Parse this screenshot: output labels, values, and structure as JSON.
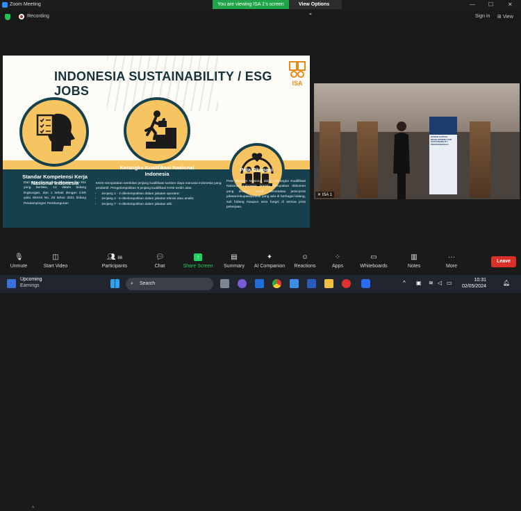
{
  "window": {
    "title": "Zoom Meeting"
  },
  "banner": {
    "message": "You are viewing ISA 1's screen",
    "options_label": "View Options"
  },
  "topbar": {
    "recording_label": "Recording",
    "signin_label": "Sign in",
    "view_label": "View"
  },
  "slide": {
    "title": "INDONESIA SUSTAINABILITY / ESG JOBS",
    "logo_text": "ISA",
    "columns": [
      {
        "title": "Standar Kompetensi Kerja Nasional Indonesia",
        "body": "Dari 1108 SKKNI yang ditetapkan dan 911 yang berlaku, 12 dalam bidang lingkungan, dan 1 terkait dengan CSR yaitu SKKNI No. 25 tahun 2021 bidang Pendampingan Pembangunan"
      },
      {
        "title": "Kerangka Kualifikasi Nasional Indonesia",
        "body": "KKNI menyatakan sembilan jenjang kualifikasi sumber daya manusia Indonesia yang produktif. Pengelompokkan 9 jenjang kualifikasi KKNI terdiri atas:",
        "bullets": [
          "Jenjang 1 - 3 dikelompokkan dalam jabatan operator;",
          "Jenjang 4 - 6 dikelompokkan dalam jabatan teknisi atau analis;",
          "Jenjang 7 - 9 dikelompokkan dalam jabatan ahli."
        ]
      },
      {
        "title": "Peta Okupasi",
        "body": "Peta Okupasi Nasional dalam Kerangka Kualifikasi Nasional Indonesia (KKNI) merupakan dokumen yang disusun untuk memetakan jenis-jenis jabatan/okupasi/profesi yang ada di berbagai bidang, sub bidang maupun area fungsi di semua jenis pekerjaan."
      }
    ]
  },
  "camera": {
    "participant_name": "ISA 1",
    "banner_text": "HUMAN CAPITAL DEVELOPMENT FOR SUSTAINABILITY PROFESSIONALS"
  },
  "toolbar": {
    "unmute": "Unmute",
    "start_video": "Start Video",
    "participants": "Participants",
    "participants_count": "86",
    "chat": "Chat",
    "share_screen": "Share Screen",
    "summary": "Summary",
    "ai_companion": "AI Companion",
    "reactions": "Reactions",
    "apps": "Apps",
    "whiteboards": "Whiteboards",
    "notes": "Notes",
    "more": "More",
    "leave": "Leave"
  },
  "taskbar": {
    "widget_title": "Upcoming",
    "widget_subtitle": "Earnings",
    "search_placeholder": "Search",
    "time": "10:31",
    "date": "02/05/2024"
  },
  "colors": {
    "accent_yellow": "#f6c562",
    "teal": "#16414c",
    "zoom_green": "#23d160",
    "leave_red": "#d9302a"
  }
}
